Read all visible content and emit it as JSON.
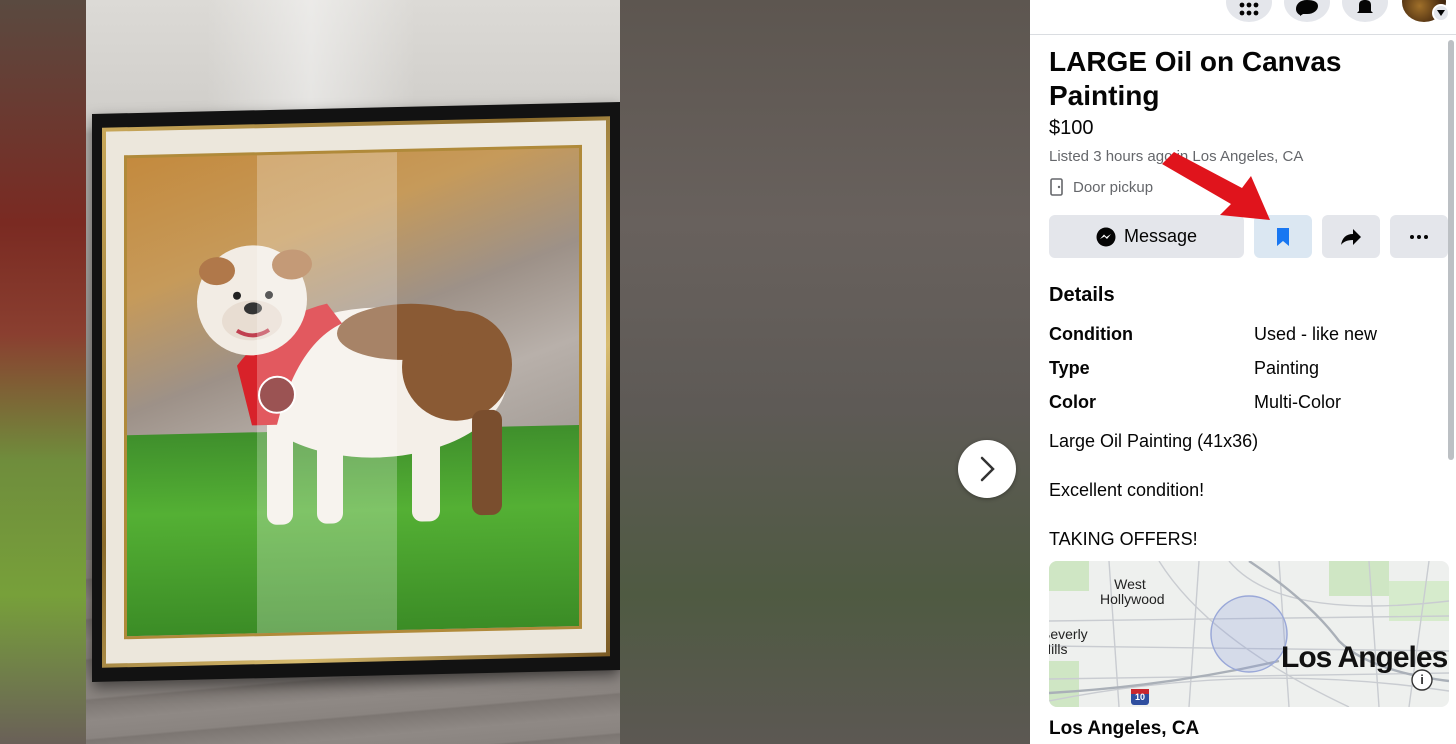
{
  "listing": {
    "title": "LARGE Oil on Canvas Painting",
    "price": "$100",
    "listed_text": "Listed 3 hours ago in Los Angeles, CA",
    "pickup_text": "Door pickup"
  },
  "actions": {
    "message_label": "Message",
    "save_icon": "bookmark-icon",
    "share_icon": "share-icon",
    "more_icon": "more-icon"
  },
  "details": {
    "heading": "Details",
    "rows": [
      {
        "key": "Condition",
        "value": "Used - like new"
      },
      {
        "key": "Type",
        "value": "Painting"
      },
      {
        "key": "Color",
        "value": "Multi-Color"
      }
    ],
    "description": [
      "Large Oil Painting (41x36)",
      "Excellent condition!",
      "TAKING OFFERS!"
    ]
  },
  "map": {
    "labels": [
      "West Hollywood",
      "Beverly Hills",
      "Los Angeles"
    ],
    "highway_shield": "10",
    "info_icon": "info-icon"
  },
  "location": "Los Angeles, CA",
  "topbar": {
    "icons": [
      "menu-grid-icon",
      "messenger-icon",
      "bell-icon",
      "account-avatar"
    ]
  },
  "colors": {
    "accent": "#1877f2",
    "annotation_arrow": "#e0141c"
  }
}
